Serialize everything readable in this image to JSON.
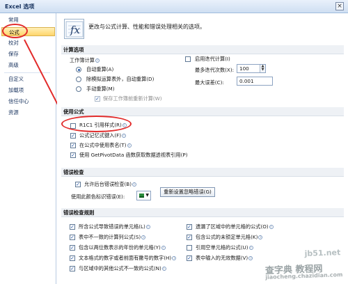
{
  "window": {
    "title": "Excel 选项",
    "close_label": "×"
  },
  "sidebar": {
    "items": [
      {
        "label": "常用"
      },
      {
        "label": "公式"
      },
      {
        "label": "校对"
      },
      {
        "label": "保存"
      },
      {
        "label": "高级"
      },
      {
        "label": "自定义"
      },
      {
        "label": "加载项"
      },
      {
        "label": "信任中心"
      },
      {
        "label": "资源"
      }
    ]
  },
  "header": {
    "description": "更改与公式计算、性能和错误处理相关的选项。"
  },
  "calc": {
    "title": "计算选项",
    "workbook_calc_label": "工作簿计算",
    "auto_label": "自动重算(A)",
    "auto_except_label": "除模拟运算表外，自动重算(D)",
    "manual_label": "手动重算(M)",
    "recalc_before_save_label": "保存工作簿前重新计算(W)",
    "enable_iter_label": "启用迭代计算(I)",
    "max_iter_label": "最多迭代次数(X):",
    "max_iter_value": "100",
    "max_change_label": "最大误差(C):",
    "max_change_value": "0.001"
  },
  "formulas": {
    "title": "使用公式",
    "r1c1_label": "R1C1 引用样式(R)",
    "autocomplete_label": "公式记忆式键入(F)",
    "table_names_label": "在公式中使用表名(T)",
    "getpivot_label": "使用 GetPivotData 函数获取数据透视表引用(P)"
  },
  "error_check": {
    "title": "错误检查",
    "background_label": "允许后台错误检查(B)",
    "color_label": "使用此颜色标识错误(E):",
    "reset_button": "重新设置忽略错误(G)"
  },
  "rules": {
    "title": "错误检查规则",
    "left": [
      "所含公式导致错误的单元格(L)",
      "表中不一致的计算列公式(S)",
      "包含以两位数表示的年份的单元格(Y)",
      "文本格式的数字或者前面有撇号的数字(H)",
      "与区域中的其他公式不一致的公式(N)"
    ],
    "right": [
      "遗漏了区域中的单元格的公式(O)",
      "包含公式的未锁定单元格(K)",
      "引用空单元格的公式(U)",
      "表中输入的无效数据(V)"
    ]
  },
  "watermark": {
    "text": "查字典 教程网",
    "site": "jiaocheng.chazidian.com",
    "short": "jb51.net"
  },
  "colors": {
    "accent": "#e22b2b",
    "selected_nav": "#ffd56a",
    "section_bg": "#eef1f5"
  }
}
